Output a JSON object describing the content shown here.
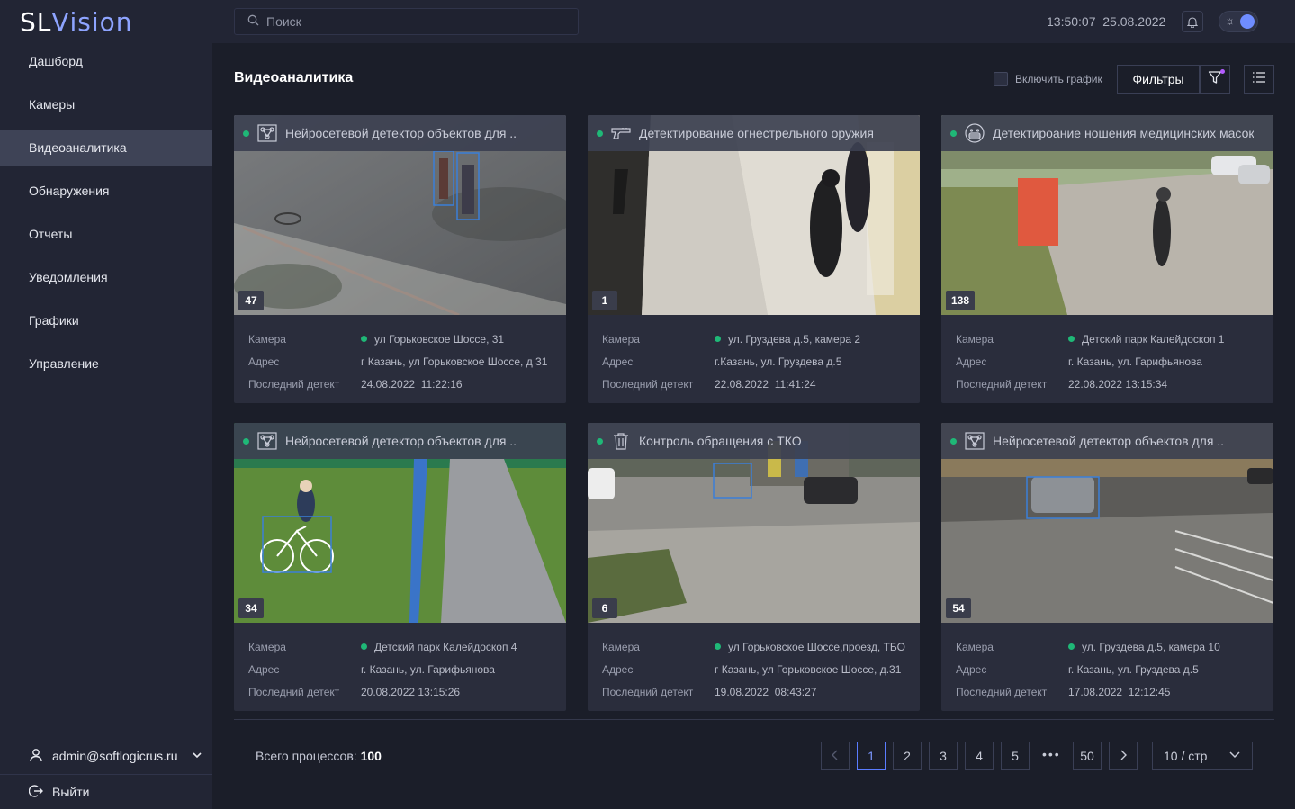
{
  "app": {
    "logo_sl": "SL",
    "logo_v": "V",
    "logo_rest": "ision"
  },
  "sidebar": {
    "items": [
      {
        "label": "Дашборд"
      },
      {
        "label": "Камеры"
      },
      {
        "label": "Видеоаналитика",
        "active": true
      },
      {
        "label": "Обнаружения"
      },
      {
        "label": "Отчеты"
      },
      {
        "label": "Уведомления"
      },
      {
        "label": "Графики"
      },
      {
        "label": "Управление"
      }
    ],
    "user": "admin@softlogicrus.ru",
    "logout": "Выйти"
  },
  "topbar": {
    "search_placeholder": "Поиск",
    "datetime": "13:50:07  25.08.2022"
  },
  "page": {
    "title": "Видеоаналитика",
    "chart_toggle_label": "Включить график",
    "filters_label": "Фильтры"
  },
  "labels": {
    "camera": "Камера",
    "address": "Адрес",
    "last_detect": "Последний детект"
  },
  "cards": [
    {
      "title": "Нейросетевой детектор объектов для ..",
      "icon": "neural-detector-icon",
      "count": "47",
      "camera": "ул Горьковское Шоссе, 31",
      "address": "г Казань, ул Горьковское Шоссе, д 31",
      "last": "24.08.2022  11:22:16"
    },
    {
      "title": "Детектирование огнестрельного оружия",
      "icon": "gun-icon",
      "count": "1",
      "camera": "ул. Груздева д.5, камера 2",
      "address": "г.Казань, ул. Груздева д.5",
      "last": "22.08.2022  11:41:24"
    },
    {
      "title": "Детектироание ношения медицинских масок",
      "icon": "mask-icon",
      "count": "138",
      "camera": "Детский парк Калейдоскоп 1",
      "address": "г. Казань, ул. Гарифьянова",
      "last": "22.08.2022 13:15:34"
    },
    {
      "title": "Нейросетевой детектор объектов для ..",
      "icon": "neural-detector-icon",
      "count": "34",
      "camera": "Детский парк Калейдоскоп 4",
      "address": "г. Казань, ул. Гарифьянова",
      "last": "20.08.2022 13:15:26"
    },
    {
      "title": "Контроль обращения с ТКО",
      "icon": "trash-icon",
      "count": "6",
      "camera": "ул Горьковское Шоссе,проезд, ТБО",
      "address": "г Казань, ул Горьковское Шоссе, д.31",
      "last": "19.08.2022  08:43:27"
    },
    {
      "title": "Нейросетевой детектор объектов для ..",
      "icon": "neural-detector-icon",
      "count": "54",
      "camera": "ул. Груздева д.5, камера 10",
      "address": "г. Казань, ул. Груздева д.5",
      "last": "17.08.2022  12:12:45"
    }
  ],
  "footer": {
    "total_label": "Всего процессов:",
    "total_value": "100",
    "pages": [
      "1",
      "2",
      "3",
      "4",
      "5",
      "50"
    ],
    "ellipsis": "•••",
    "page_size": "10 / стр"
  },
  "colors": {
    "accent": "#5a7cff",
    "status_green": "#1fb877",
    "background": "#1b1e29",
    "sidebar": "#222534"
  }
}
